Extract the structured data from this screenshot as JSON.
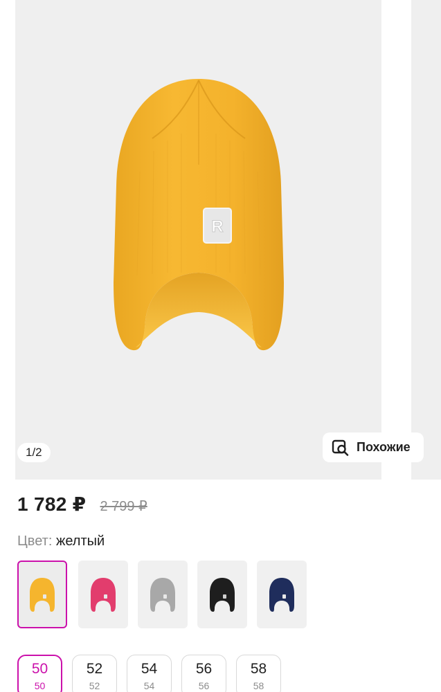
{
  "gallery": {
    "counter": "1/2",
    "similar_label": "Похожие",
    "logo_letter": "R"
  },
  "price": {
    "current": "1 782 ₽",
    "old": "2 799 ₽"
  },
  "color": {
    "label": "Цвет:",
    "value": "желтый",
    "swatches": [
      {
        "name": "yellow",
        "hex": "#f5b52e",
        "selected": true
      },
      {
        "name": "pink",
        "hex": "#e23d6d",
        "selected": false
      },
      {
        "name": "grey",
        "hex": "#a8a8a8",
        "selected": false
      },
      {
        "name": "black",
        "hex": "#1e1e1e",
        "selected": false
      },
      {
        "name": "navy",
        "hex": "#1f2d5c",
        "selected": false
      }
    ]
  },
  "sizes": [
    {
      "main": "50",
      "sub": "50",
      "selected": true
    },
    {
      "main": "52",
      "sub": "52",
      "selected": false
    },
    {
      "main": "54",
      "sub": "54",
      "selected": false
    },
    {
      "main": "56",
      "sub": "56",
      "selected": false
    },
    {
      "main": "58",
      "sub": "58",
      "selected": false
    }
  ],
  "colors": {
    "accent": "#cb11ab",
    "hat_main": "#f5b52e",
    "hat_inner": "#f8c040",
    "muted_text": "#8c8c8c"
  }
}
